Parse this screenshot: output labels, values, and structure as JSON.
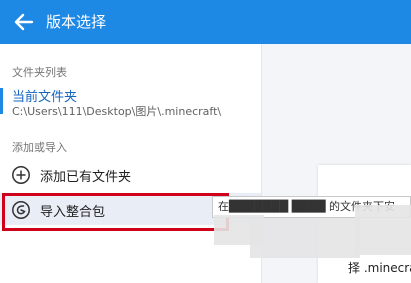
{
  "header": {
    "title": "版本选择",
    "back_icon": "arrow-left-icon"
  },
  "sidebar": {
    "folder_list_label": "文件夹列表",
    "current_folder": {
      "title": "当前文件夹",
      "path": "C:\\Users\\111\\Desktop\\图片\\.minecraft\\"
    },
    "add_or_import_label": "添加或导入",
    "actions": [
      {
        "label": "添加已有文件夹",
        "icon": "plus-circle-icon"
      },
      {
        "label": "导入整合包",
        "icon": "package-import-icon"
      }
    ]
  },
  "tooltip": {
    "text": "在███████ ████ 的文件夹下安"
  },
  "main": {
    "card_text": "择 .minecra"
  },
  "colors": {
    "accent": "#1e88e5",
    "highlight": "#d0021b",
    "selected_bg": "#e9edf6"
  }
}
